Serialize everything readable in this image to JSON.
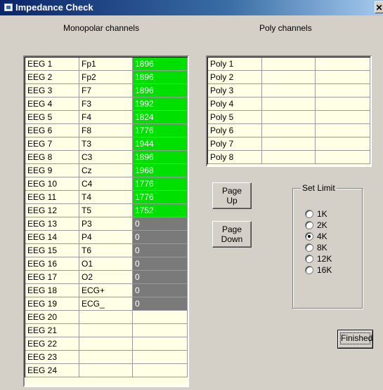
{
  "window": {
    "title": "Impedance Check"
  },
  "monopolar": {
    "label": "Monopolar channels",
    "rows": [
      {
        "channel": "EEG 1",
        "electrode": "Fp1",
        "value": "1896",
        "status": "green"
      },
      {
        "channel": "EEG 2",
        "electrode": "Fp2",
        "value": "1896",
        "status": "green"
      },
      {
        "channel": "EEG 3",
        "electrode": "F7",
        "value": "1896",
        "status": "green"
      },
      {
        "channel": "EEG 4",
        "electrode": "F3",
        "value": "1992",
        "status": "green"
      },
      {
        "channel": "EEG 5",
        "electrode": "F4",
        "value": "1824",
        "status": "green"
      },
      {
        "channel": "EEG 6",
        "electrode": "F8",
        "value": "1776",
        "status": "green"
      },
      {
        "channel": "EEG 7",
        "electrode": "T3",
        "value": "1944",
        "status": "green"
      },
      {
        "channel": "EEG 8",
        "electrode": "C3",
        "value": "1896",
        "status": "green"
      },
      {
        "channel": "EEG 9",
        "electrode": "Cz",
        "value": "1968",
        "status": "green"
      },
      {
        "channel": "EEG 10",
        "electrode": "C4",
        "value": "1776",
        "status": "green"
      },
      {
        "channel": "EEG 11",
        "electrode": "T4",
        "value": "1776",
        "status": "green"
      },
      {
        "channel": "EEG 12",
        "electrode": "T5",
        "value": "1752",
        "status": "green"
      },
      {
        "channel": "EEG 13",
        "electrode": "P3",
        "value": "0",
        "status": "gray"
      },
      {
        "channel": "EEG 14",
        "electrode": "P4",
        "value": "0",
        "status": "gray"
      },
      {
        "channel": "EEG 15",
        "electrode": "T6",
        "value": "0",
        "status": "gray"
      },
      {
        "channel": "EEG 16",
        "electrode": "O1",
        "value": "0",
        "status": "gray"
      },
      {
        "channel": "EEG 17",
        "electrode": "O2",
        "value": "0",
        "status": "gray"
      },
      {
        "channel": "EEG 18",
        "electrode": "ECG+",
        "value": "0",
        "status": "gray"
      },
      {
        "channel": "EEG 19",
        "electrode": "ECG_",
        "value": "0",
        "status": "gray"
      },
      {
        "channel": "EEG 20",
        "electrode": "",
        "value": "",
        "status": "empty"
      },
      {
        "channel": "EEG 21",
        "electrode": "",
        "value": "",
        "status": "empty"
      },
      {
        "channel": "EEG 22",
        "electrode": "",
        "value": "",
        "status": "empty"
      },
      {
        "channel": "EEG 23",
        "electrode": "",
        "value": "",
        "status": "empty"
      },
      {
        "channel": "EEG 24",
        "electrode": "",
        "value": "",
        "status": "empty"
      }
    ]
  },
  "poly": {
    "label": "Poly channels",
    "rows": [
      {
        "channel": "Poly 1",
        "electrode": "",
        "value": ""
      },
      {
        "channel": "Poly 2",
        "electrode": "",
        "value": ""
      },
      {
        "channel": "Poly 3",
        "electrode": "",
        "value": ""
      },
      {
        "channel": "Poly 4",
        "electrode": "",
        "value": ""
      },
      {
        "channel": "Poly 5",
        "electrode": "",
        "value": ""
      },
      {
        "channel": "Poly 6",
        "electrode": "",
        "value": ""
      },
      {
        "channel": "Poly 7",
        "electrode": "",
        "value": ""
      },
      {
        "channel": "Poly 8",
        "electrode": "",
        "value": ""
      }
    ]
  },
  "buttons": {
    "page_up": [
      "Page",
      "Up"
    ],
    "page_down": [
      "Page",
      "Down"
    ],
    "finished": "Finished"
  },
  "set_limit": {
    "label": "Set Limit",
    "options": [
      "1K",
      "2K",
      "4K",
      "8K",
      "12K",
      "16K"
    ],
    "selected": "4K"
  },
  "colors": {
    "good": "#00e000",
    "bad": "#7a7a7a",
    "cell_bg": "#ffffe6",
    "title_bar": "#0a246a"
  }
}
